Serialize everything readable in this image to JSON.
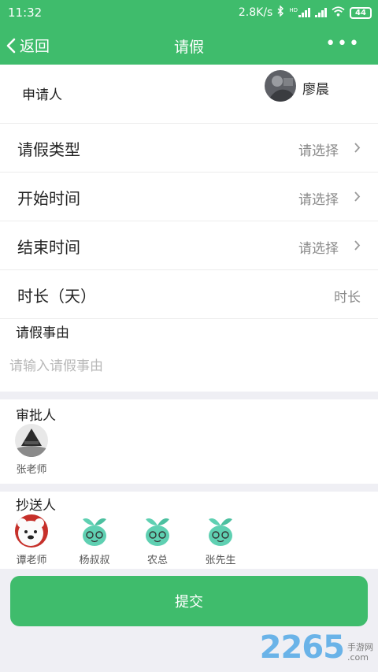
{
  "status": {
    "time": "11:32",
    "speed": "2.8K/s",
    "network": "HD",
    "battery": "44"
  },
  "nav": {
    "back_label": "返回",
    "title": "请假"
  },
  "applicant": {
    "label": "申请人",
    "name": "廖晨"
  },
  "fields": [
    {
      "label": "请假类型",
      "value": "请选择"
    },
    {
      "label": "开始时间",
      "value": "请选择"
    },
    {
      "label": "结束时间",
      "value": "请选择"
    },
    {
      "label": "时长（天）",
      "value": "时长"
    }
  ],
  "reason": {
    "label": "请假事由",
    "placeholder": "请输入请假事由"
  },
  "approver": {
    "label": "审批人",
    "people": [
      {
        "name": "张老师"
      }
    ]
  },
  "cc": {
    "label": "抄送人",
    "people": [
      {
        "name": "谭老师"
      },
      {
        "name": "杨叔叔"
      },
      {
        "name": "农总"
      },
      {
        "name": "张先生"
      }
    ]
  },
  "submit_label": "提交",
  "watermark": {
    "brand": "2265",
    "cn": "手游网",
    "domain": ".com"
  },
  "colors": {
    "primary": "#3fbc6c",
    "band": "#efeff4",
    "placeholder": "#b8b8b8"
  }
}
